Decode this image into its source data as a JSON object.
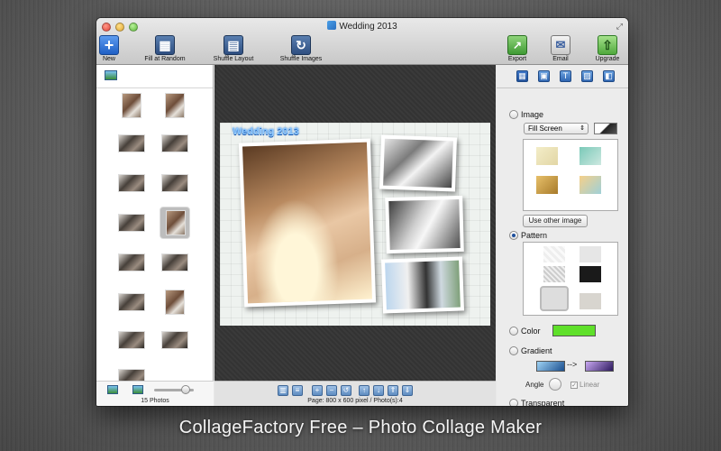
{
  "window": {
    "title": "Wedding 2013"
  },
  "toolbar": {
    "new_label": "New",
    "fill_label": "Fill at Random",
    "shuffle_layout_label": "Shuffle Layout",
    "shuffle_images_label": "Shuffle Images",
    "export_label": "Export",
    "email_label": "Email",
    "upgrade_label": "Upgrade"
  },
  "left_panel": {
    "photo_count": "15 Photos"
  },
  "canvas": {
    "title": "Wedding 2013",
    "page_info": "Page: 800 x 600 pixel / Photo(s):4"
  },
  "right_panel": {
    "image_label": "Image",
    "fill_option": "Fill Screen",
    "use_other_image": "Use other image",
    "pattern_label": "Pattern",
    "color_label": "Color",
    "color_value": "#5fe02a",
    "gradient_label": "Gradient",
    "gradient_arrow": "-->",
    "angle_label": "Angle",
    "linear_label": "Linear",
    "transparent_label": "Transparent",
    "selected": "Pattern"
  },
  "caption": "CollageFactory Free – Photo Collage Maker"
}
